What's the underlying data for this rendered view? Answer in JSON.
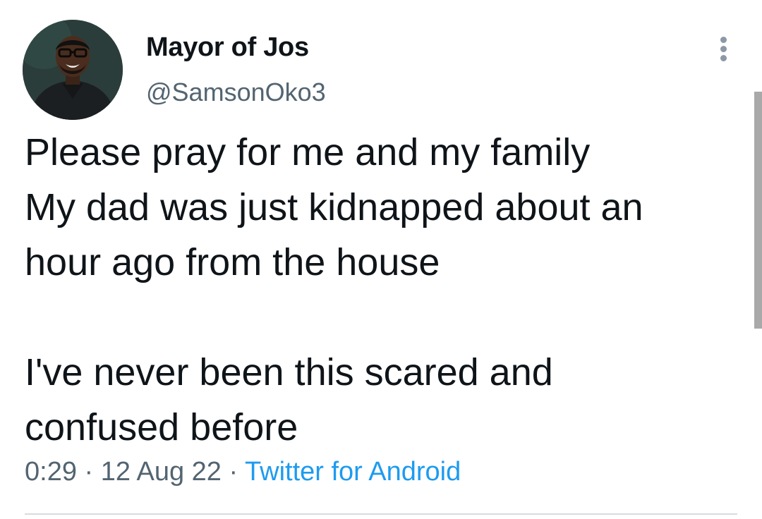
{
  "tweet": {
    "author": {
      "display_name": "Mayor of Jos",
      "handle": "@SamsonOko3",
      "avatar_icon": "profile-photo"
    },
    "more_icon": "more-vertical-icon",
    "text": "Please pray for me and my family\nMy dad was just kidnapped about an\nhour ago from the house\n\nI've never been this scared and\nconfused before",
    "time": "0:29",
    "date": "12 Aug 22",
    "separator": "·",
    "source": "Twitter for Android"
  },
  "colors": {
    "text": "#0f1419",
    "secondary": "#536471",
    "link": "#1d9bf0",
    "background": "#ffffff"
  }
}
